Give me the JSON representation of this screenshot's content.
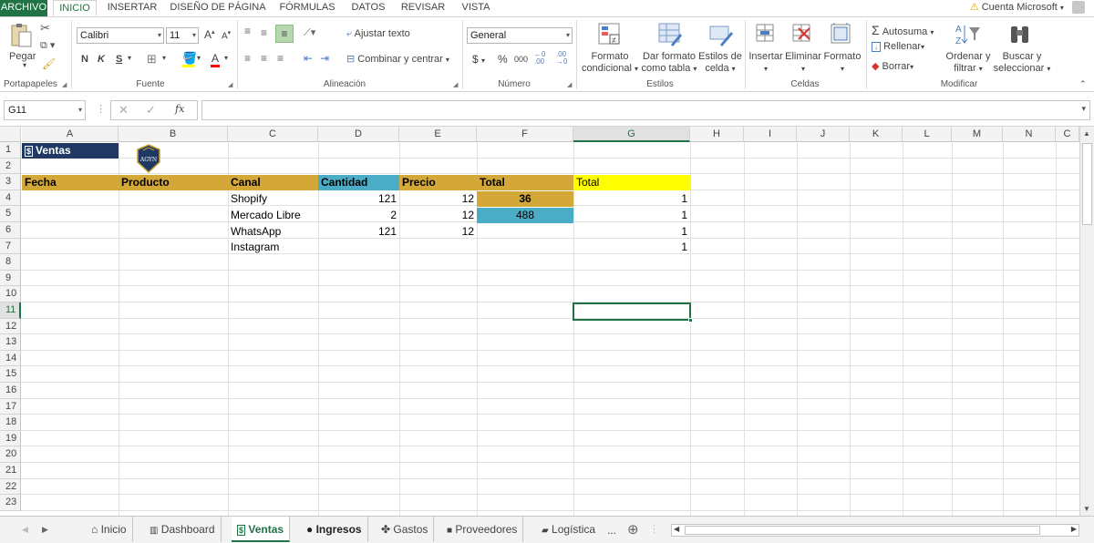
{
  "colors": {
    "accent": "#217346",
    "header_gold": "#d4a838",
    "header_blue": "#4bacc6",
    "yellow": "#ffff00",
    "title_navy": "#1f3864"
  },
  "menu": {
    "tabs": [
      "ARCHIVO",
      "INICIO",
      "INSERTAR",
      "DISEÑO DE PÁGINA",
      "FÓRMULAS",
      "DATOS",
      "REVISAR",
      "VISTA"
    ],
    "account": "Cuenta Microsoft"
  },
  "ribbon": {
    "groups": [
      "Portapapeles",
      "Fuente",
      "Alineación",
      "Número",
      "Estilos",
      "Celdas",
      "Modificar"
    ],
    "paste": "Pegar",
    "font_name": "Calibri",
    "font_size": "11",
    "bold": "N",
    "italic": "K",
    "underline": "S",
    "wrap_text": "Ajustar texto",
    "merge_center": "Combinar y centrar",
    "number_format": "General",
    "currency": "$",
    "percent": "%",
    "thousands": "000",
    "cond_format": [
      "Formato",
      "condicional"
    ],
    "format_table": [
      "Dar formato",
      "como tabla"
    ],
    "cell_styles": [
      "Estilos de",
      "celda"
    ],
    "insert": "Insertar",
    "delete": "Eliminar",
    "format": "Formato",
    "autosum": "Autosuma",
    "fill": "Rellenar",
    "clear": "Borrar",
    "sort_filter": [
      "Ordenar y",
      "filtrar"
    ],
    "find_select": [
      "Buscar y",
      "seleccionar"
    ]
  },
  "formula_bar": {
    "name_box": "G11",
    "fx": "fx",
    "value": ""
  },
  "grid": {
    "columns": [
      "A",
      "B",
      "C",
      "D",
      "E",
      "F",
      "G",
      "H",
      "I",
      "J",
      "K",
      "L",
      "M",
      "N",
      "C"
    ],
    "selected_column": "G",
    "selected_row": 11,
    "rows": [
      "1",
      "2",
      "3",
      "4",
      "5",
      "6",
      "7",
      "8",
      "9",
      "10",
      "11",
      "12",
      "13",
      "14",
      "15",
      "16",
      "17",
      "18",
      "19",
      "20",
      "21",
      "22",
      "23"
    ]
  },
  "sheet": {
    "title": "Ventas",
    "logo_text": "AGYN",
    "headers": [
      "Fecha",
      "Producto",
      "Canal",
      "Cantidad",
      "Precio",
      "Total",
      "Total"
    ],
    "rows": [
      {
        "canal": "Shopify",
        "cantidad": "121",
        "precio": "12",
        "total": "36",
        "total2": "1"
      },
      {
        "canal": "Mercado Libre",
        "cantidad": "2",
        "precio": "12",
        "total": "488",
        "total2": "1"
      },
      {
        "canal": "WhatsApp",
        "cantidad": "121",
        "precio": "12",
        "total": "",
        "total2": "1"
      },
      {
        "canal": "Instagram",
        "cantidad": "",
        "precio": "",
        "total": "",
        "total2": "1"
      }
    ]
  },
  "sheet_tabs": [
    "Inicio",
    "Dashboard",
    "Ventas",
    "Ingresos",
    "Gastos",
    "Proveedores",
    "Logística"
  ],
  "sheet_tabs_more": "..."
}
